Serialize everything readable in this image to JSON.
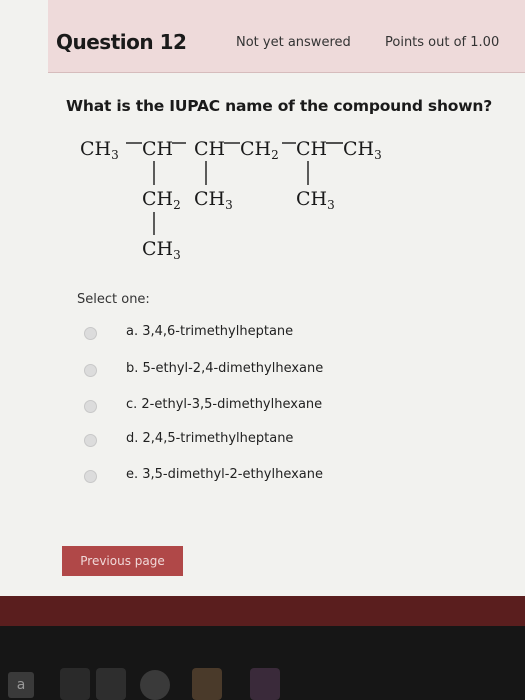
{
  "header": {
    "question_label": "Question 12",
    "status": "Not yet answered",
    "points": "Points out of 1.00"
  },
  "question": {
    "text": "What is the IUPAC name of the compound shown?"
  },
  "structure": {
    "main_chain": [
      "CH3",
      "CH",
      "CH",
      "CH2",
      "CH",
      "CH3"
    ],
    "substituents": [
      "CH2",
      "CH3",
      "CH3",
      "CH3"
    ]
  },
  "answer": {
    "select_label": "Select one:",
    "options": [
      "a. 3,4,6-trimethylheptane",
      "b. 5-ethyl-2,4-dimethylhexane",
      "c. 2-ethyl-3,5-dimethylhexane",
      "d. 2,4,5-trimethylheptane",
      "e. 3,5-dimethyl-2-ethylhexane"
    ]
  },
  "navigation": {
    "previous_label": "Previous page"
  },
  "taskbar": {
    "app_letter": "a"
  },
  "colors": {
    "header_bg": "#eedada",
    "button_bg": "#b04848",
    "dark_band": "#5a1e1e"
  }
}
